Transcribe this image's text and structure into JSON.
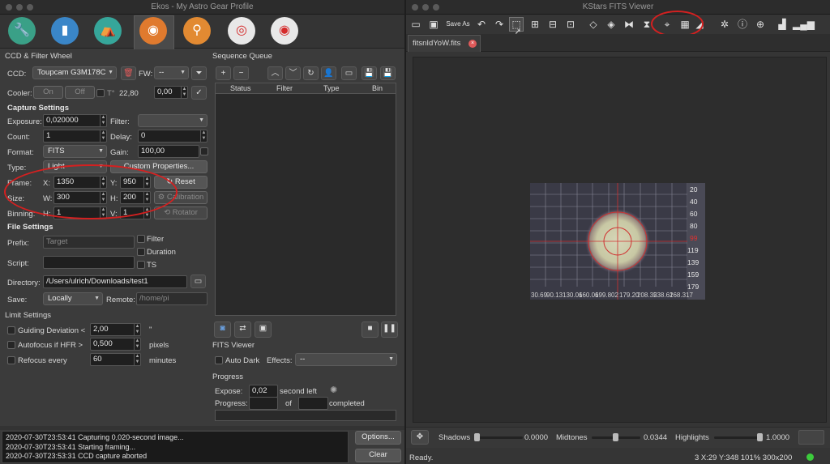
{
  "ekos": {
    "window_title": "Ekos - My Astro Gear Profile",
    "ccd_section_label": "CCD & Filter Wheel",
    "ccd_label": "CCD:",
    "ccd_value": "Toupcam G3M178C",
    "fw_label": "FW:",
    "fw_value": "--",
    "cooler_label": "Cooler:",
    "cooler_on": "On",
    "cooler_off": "Off",
    "temp_label": "T°",
    "temp_value": "22,80",
    "temp_set": "0,00",
    "capture_settings": "Capture Settings",
    "exposure_label": "Exposure:",
    "exposure_value": "0,020000",
    "filter_label": "Filter:",
    "filter_value": "",
    "count_label": "Count:",
    "count_value": "1",
    "delay_label": "Delay:",
    "delay_value": "0",
    "format_label": "Format:",
    "format_value": "FITS",
    "gain_label": "Gain:",
    "gain_value": "100,00",
    "type_label": "Type:",
    "type_value": "Light",
    "custom_props": "Custom Properties...",
    "frame_label": "Frame:",
    "x_label": "X:",
    "x_value": "1350",
    "y_label": "Y:",
    "y_value": "950",
    "reset": "Reset",
    "size_label": "Size:",
    "w_label": "W:",
    "w_value": "300",
    "h_label": "H:",
    "h_value": "200",
    "calibration": "Calibration",
    "binning_label": "Binning:",
    "binh_label": "H:",
    "binh_value": "1",
    "binv_label": "V:",
    "binv_value": "1",
    "rotator": "Rotator",
    "file_settings": "File Settings",
    "prefix_label": "Prefix:",
    "prefix_placeholder": "Target",
    "filter_chk": "Filter",
    "duration_chk": "Duration",
    "ts_chk": "TS",
    "script_label": "Script:",
    "directory_label": "Directory:",
    "directory_value": "/Users/ulrich/Downloads/test1",
    "save_label": "Save:",
    "save_value": "Locally",
    "remote_label": "Remote:",
    "remote_value": "/home/pi",
    "limit_settings": "Limit Settings",
    "guiding_label": "Guiding Deviation <",
    "guiding_value": "2,00",
    "guiding_unit": "\"",
    "autofocus_label": "Autofocus if HFR >",
    "autofocus_value": "0,500",
    "autofocus_unit": "pixels",
    "refocus_label": "Refocus every",
    "refocus_value": "60",
    "refocus_unit": "minutes",
    "seq_queue": "Sequence Queue",
    "seq_cols": [
      "Status",
      "Filter",
      "Type",
      "Bin"
    ],
    "fits_viewer_label": "FITS Viewer",
    "auto_dark": "Auto Dark",
    "effects_label": "Effects:",
    "effects_value": "--",
    "progress_label": "Progress",
    "expose_label": "Expose:",
    "expose_value": "0,02",
    "second_left": "second left",
    "progress_row_label": "Progress:",
    "of_label": "of",
    "completed_label": "completed",
    "log": [
      "2020-07-30T23:53:41 Capturing 0,020-second  image...",
      "2020-07-30T23:53:41 Starting framing...",
      "2020-07-30T23:53:31 CCD capture aborted"
    ],
    "options_btn": "Options...",
    "clear_btn": "Clear"
  },
  "fits": {
    "window_title": "KStars FITS Viewer",
    "save_as": "Save As",
    "tab_name": "fitsnIdYoW.fits",
    "grid_right": [
      "20",
      "40",
      "60",
      "80",
      "99",
      "119",
      "139",
      "159",
      "179"
    ],
    "grid_bottom": [
      "30.69",
      "90.13",
      "130.06",
      "160.06",
      "199.802",
      "179.20",
      "208.35",
      "238.61",
      "268.317"
    ],
    "shadows_label": "Shadows",
    "shadows_value": "0.0000",
    "midtones_label": "Midtones",
    "midtones_value": "0.0344",
    "highlights_label": "Highlights",
    "highlights_value": "1.0000",
    "status_ready": "Ready.",
    "status_info": "3  X:29 Y:348  101%  300x200"
  },
  "colors": {
    "annotation": "#d42020",
    "accent": "#e05a5a"
  }
}
